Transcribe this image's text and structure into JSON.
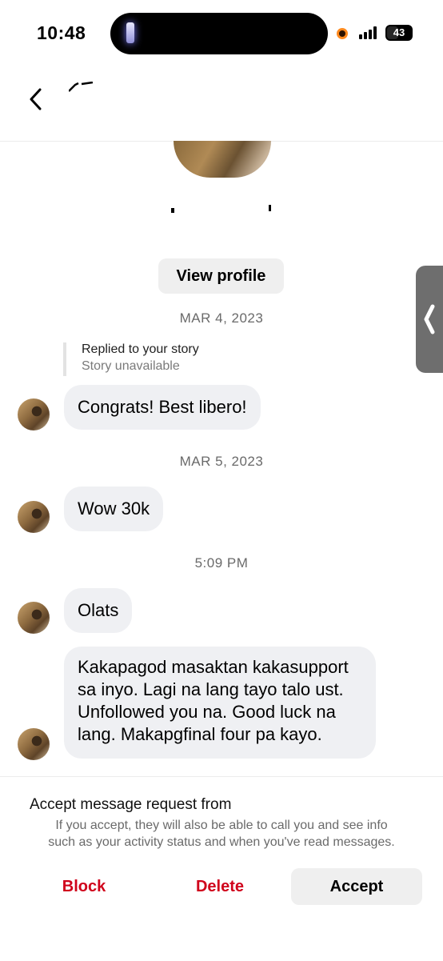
{
  "status_bar": {
    "time": "10:48",
    "battery_level": "43",
    "icons": [
      "flashlight-icon",
      "recording-dot-icon",
      "signal-icon",
      "battery-icon"
    ]
  },
  "header": {
    "back_icon": "chevron-left-icon"
  },
  "profile": {
    "view_profile_label": "View profile"
  },
  "conversation": {
    "date_1": "MAR 4, 2023",
    "story_reply": {
      "label": "Replied to your story",
      "status": "Story unavailable"
    },
    "msg_1": "Congrats! Best libero!",
    "date_2": "MAR 5, 2023",
    "msg_2": "Wow 30k",
    "time_3": "5:09 PM",
    "msg_3": "Olats",
    "msg_4": {
      "lines": [
        "Kakapagod masaktan kakasupport",
        "sa inyo. Lagi na lang tayo talo ust.",
        "Unfollowed you na. Good luck na",
        "lang. Makapgfinal four pa kayo."
      ]
    }
  },
  "request": {
    "title": "Accept message request from",
    "description_line_1": "If you accept, they will also be able to call you and see info",
    "description_line_2": "such as your activity status and when you've read messages.",
    "block_label": "Block",
    "delete_label": "Delete",
    "accept_label": "Accept"
  },
  "colors": {
    "bubble_bg": "#eff0f3",
    "destructive": "#d0021b",
    "secondary_text": "#6a6a6a",
    "button_bg": "#efefef"
  }
}
